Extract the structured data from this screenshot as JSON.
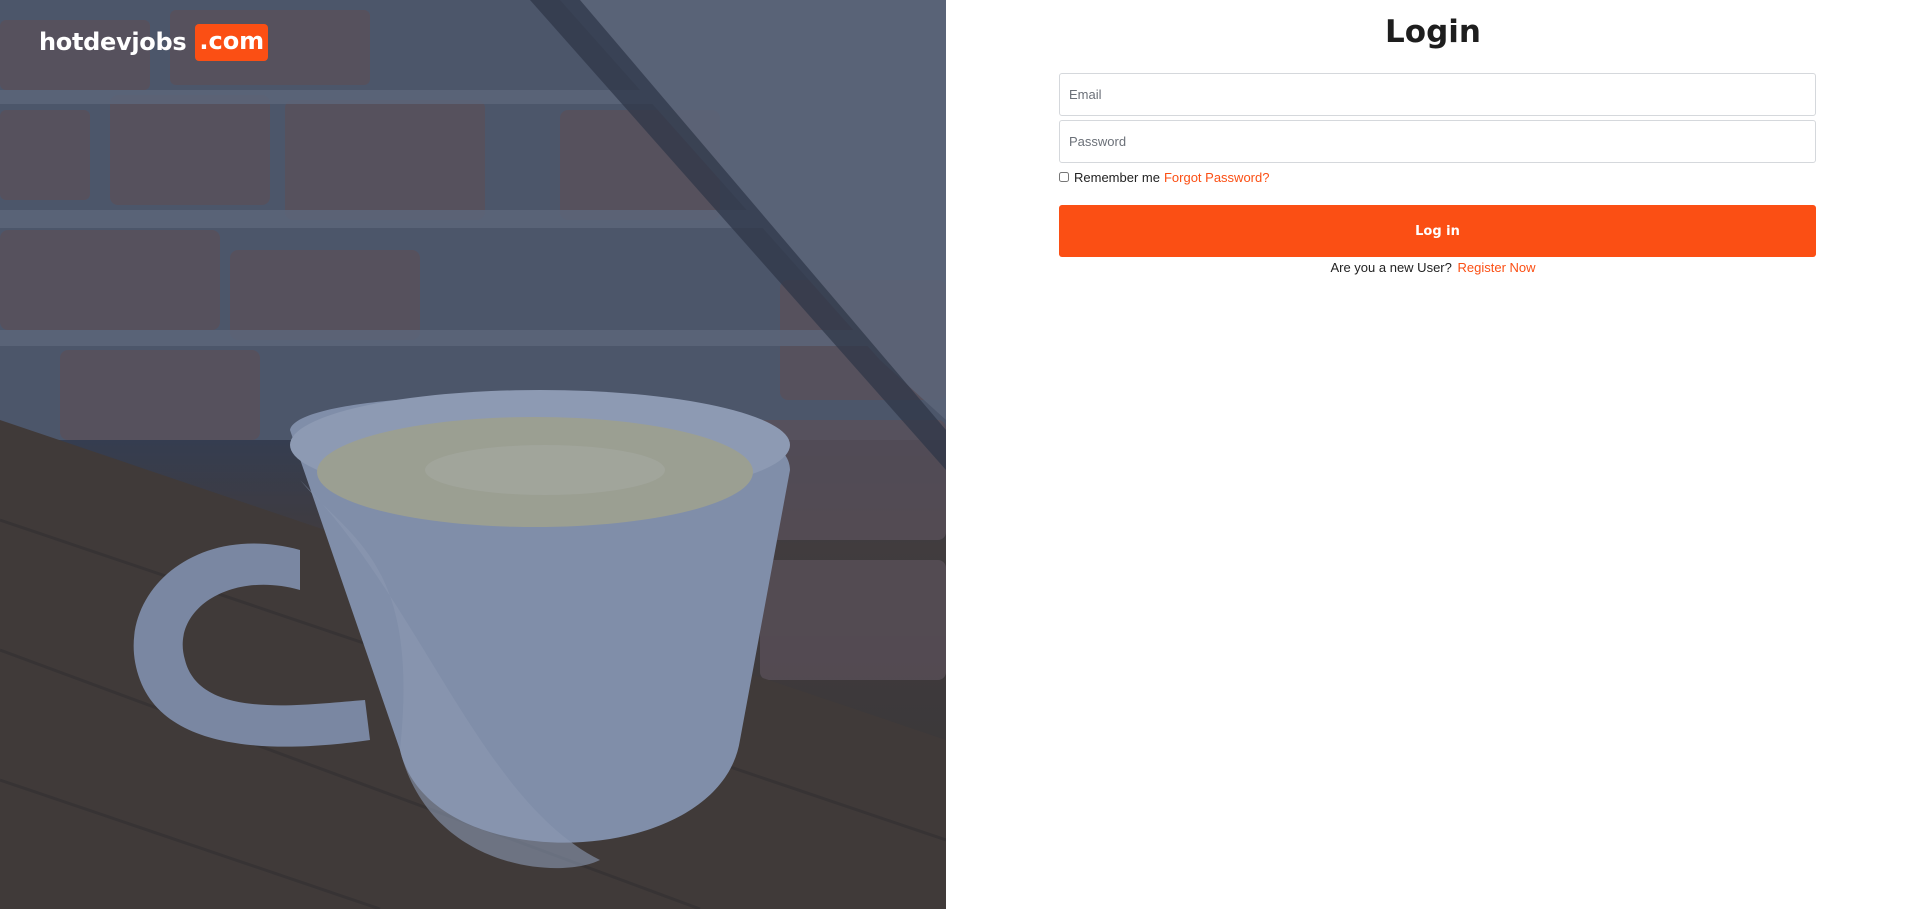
{
  "brand": {
    "name": "hotdevjobs",
    "tld": ".com",
    "accent_color": "#fb4f14"
  },
  "hero": {
    "image_subject": "coffee-cup-photo"
  },
  "login": {
    "title": "Login",
    "email_placeholder": "Email",
    "password_placeholder": "Password",
    "remember_label": "Remember me",
    "forgot_label": "Forgot Password?",
    "submit_label": "Log in",
    "new_user_text": "Are you a new User?",
    "register_label": "Register Now"
  }
}
